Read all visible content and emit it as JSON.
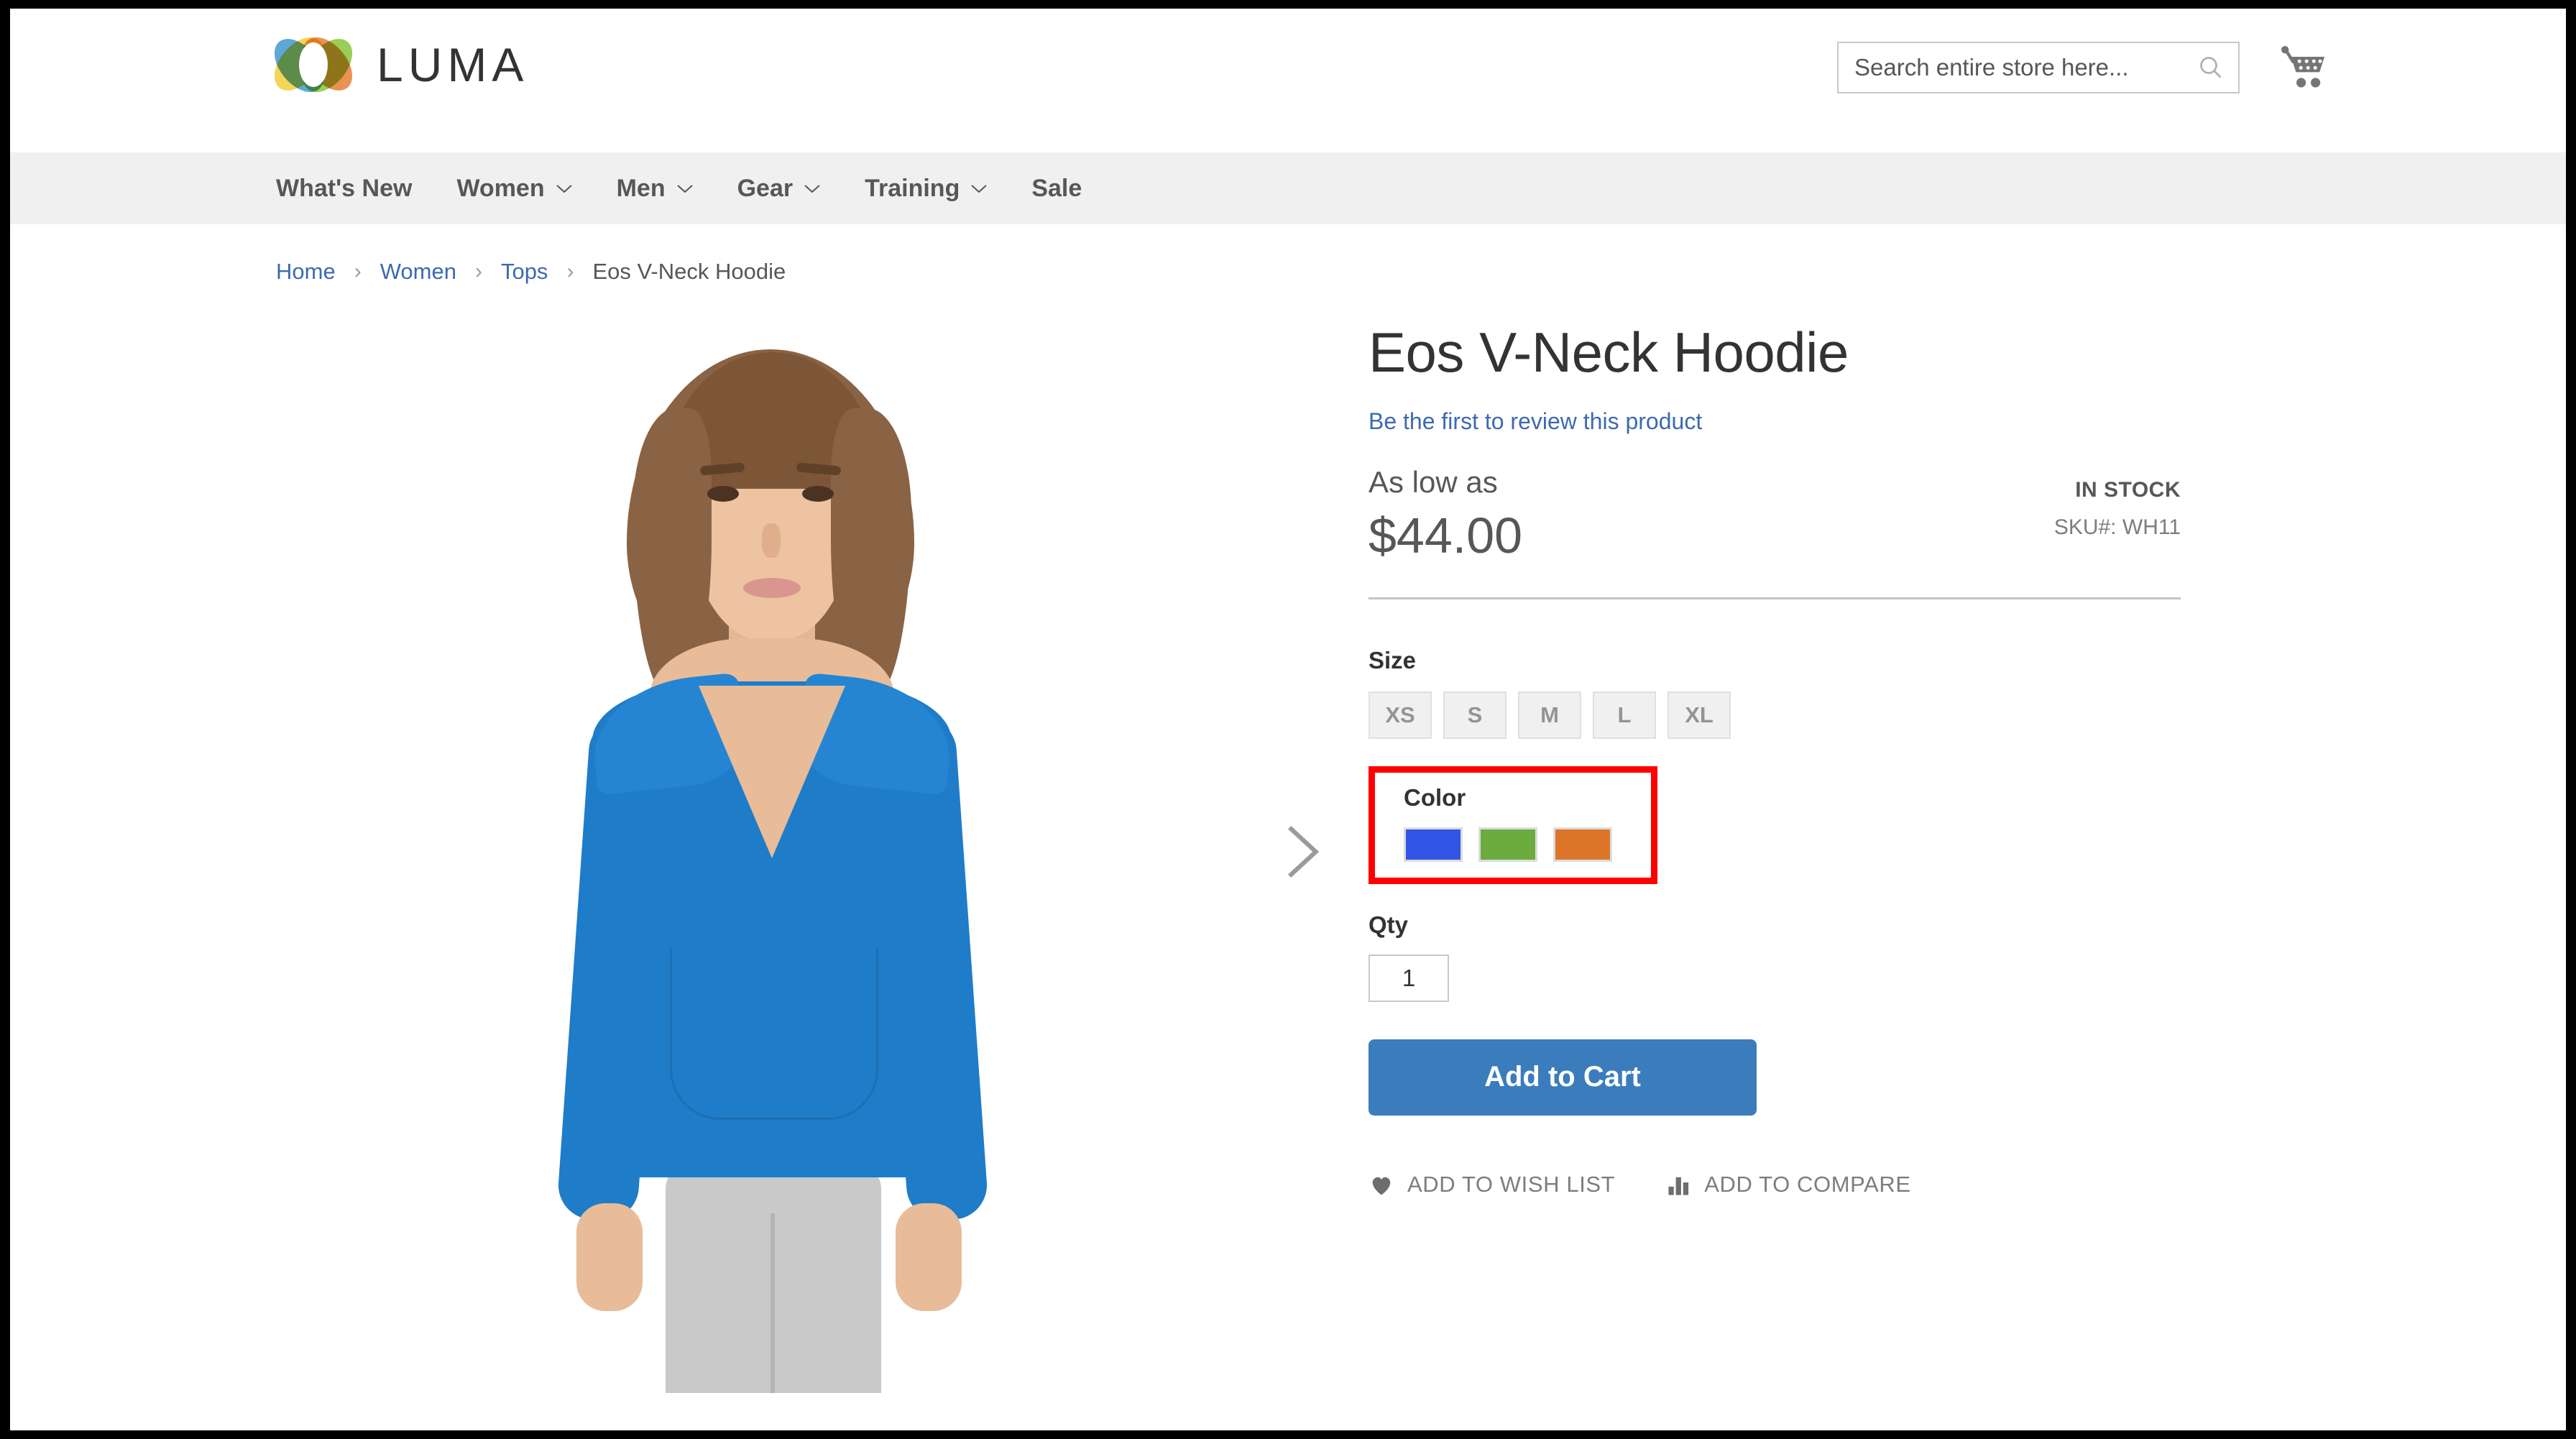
{
  "header": {
    "logo_text": "LUMA",
    "search": {
      "placeholder": "Search entire store here...",
      "value": ""
    },
    "cart_icon": "shopping-cart-icon",
    "search_icon": "search-icon"
  },
  "nav": {
    "items": [
      {
        "label": "What's New",
        "has_caret": false
      },
      {
        "label": "Women",
        "has_caret": true
      },
      {
        "label": "Men",
        "has_caret": true
      },
      {
        "label": "Gear",
        "has_caret": true
      },
      {
        "label": "Training",
        "has_caret": true
      },
      {
        "label": "Sale",
        "has_caret": false
      }
    ]
  },
  "breadcrumb": {
    "items": [
      "Home",
      "Women",
      "Tops"
    ],
    "current": "Eos V-Neck Hoodie",
    "separator": "›"
  },
  "gallery": {
    "next_arrow_icon": "chevron-right-icon",
    "image_alt": "Eos V-Neck Hoodie worn by model in blue"
  },
  "product": {
    "title": "Eos V-Neck Hoodie",
    "review_link": "Be the first to review this product",
    "as_low_as": "As low as",
    "price": "$44.00",
    "stock_status": "IN STOCK",
    "sku_label": "SKU#:",
    "sku_value": "WH11",
    "size": {
      "label": "Size",
      "options": [
        "XS",
        "S",
        "M",
        "L",
        "XL"
      ]
    },
    "color": {
      "label": "Color",
      "options": [
        {
          "name": "Blue",
          "hex": "#3355e5"
        },
        {
          "name": "Green",
          "hex": "#6cab3e"
        },
        {
          "name": "Orange",
          "hex": "#dd7528"
        }
      ],
      "highlight_color": "#ff0000"
    },
    "qty": {
      "label": "Qty",
      "value": "1"
    },
    "add_to_cart_label": "Add to Cart",
    "wish_list_label": "ADD TO WISH LIST",
    "compare_label": "ADD TO COMPARE",
    "wish_list_icon": "heart-icon",
    "compare_icon": "bar-chart-icon"
  }
}
